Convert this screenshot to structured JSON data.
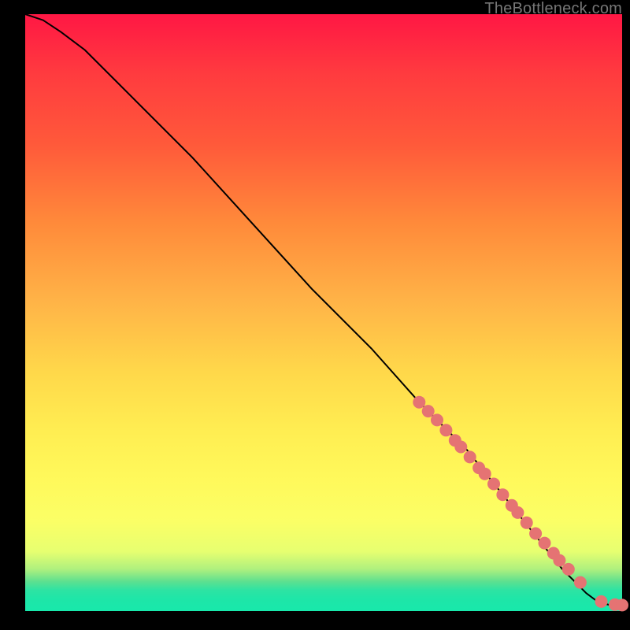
{
  "watermark": "TheBottleneck.com",
  "chart_data": {
    "type": "line",
    "title": "",
    "xlabel": "",
    "ylabel": "",
    "xlim": [
      0,
      100
    ],
    "ylim": [
      0,
      100
    ],
    "grid": false,
    "series": [
      {
        "name": "curve",
        "x": [
          0,
          3,
          6,
          10,
          18,
          28,
          38,
          48,
          58,
          66,
          70,
          74,
          78,
          82,
          86,
          90,
          92,
          94,
          96,
          98,
          100
        ],
        "y": [
          100,
          99,
          97,
          94,
          86,
          76,
          65,
          54,
          44,
          35,
          31,
          27,
          22,
          17,
          12,
          7,
          5,
          3,
          1.5,
          1,
          1
        ]
      }
    ],
    "points": {
      "name": "dots",
      "x": [
        66,
        67.5,
        69,
        70.5,
        72,
        73,
        74.5,
        76,
        77,
        78.5,
        80,
        81.5,
        82.5,
        84,
        85.5,
        87,
        88.5,
        89.5,
        91,
        93,
        96.5,
        98.8,
        100
      ],
      "y": [
        35,
        33.5,
        32,
        30.3,
        28.6,
        27.5,
        25.8,
        24,
        23,
        21.3,
        19.5,
        17.7,
        16.5,
        14.8,
        13,
        11.4,
        9.7,
        8.5,
        7,
        4.8,
        1.6,
        1.1,
        1
      ],
      "radius": 8
    }
  }
}
